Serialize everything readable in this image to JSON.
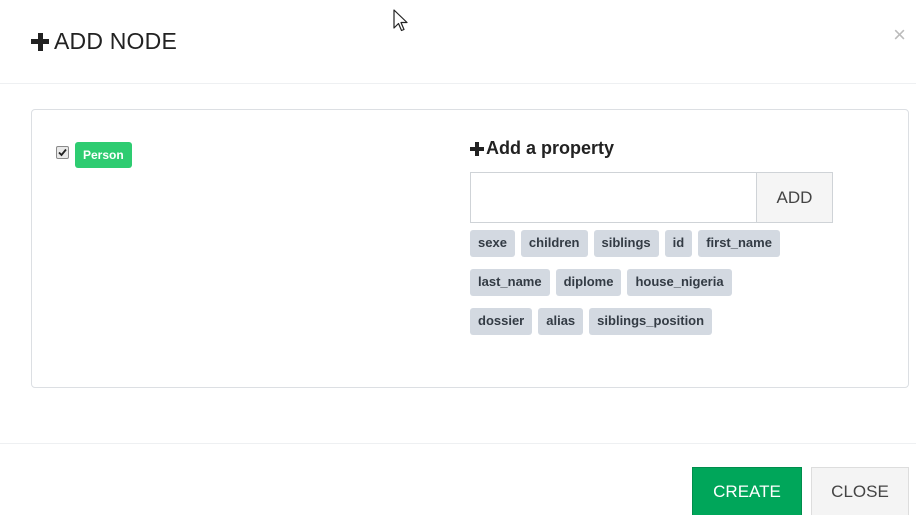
{
  "header": {
    "title": "ADD NODE",
    "close_symbol": "×"
  },
  "node": {
    "label_checked": true,
    "label": "Person",
    "label_color": "#2ecc71"
  },
  "properties": {
    "title": "Add a property",
    "input_value": "",
    "add_button_label": "ADD",
    "tag_rows": [
      [
        "sexe",
        "children",
        "siblings",
        "id",
        "first_name"
      ],
      [
        "last_name",
        "diplome",
        "house_nigeria"
      ],
      [
        "dossier",
        "alias",
        "siblings_position"
      ]
    ]
  },
  "footer": {
    "create_label": "CREATE",
    "close_label": "CLOSE",
    "create_color": "#00a65a"
  },
  "icons": [
    "plus-icon",
    "close-icon",
    "check-icon",
    "mouse-cursor-icon"
  ]
}
